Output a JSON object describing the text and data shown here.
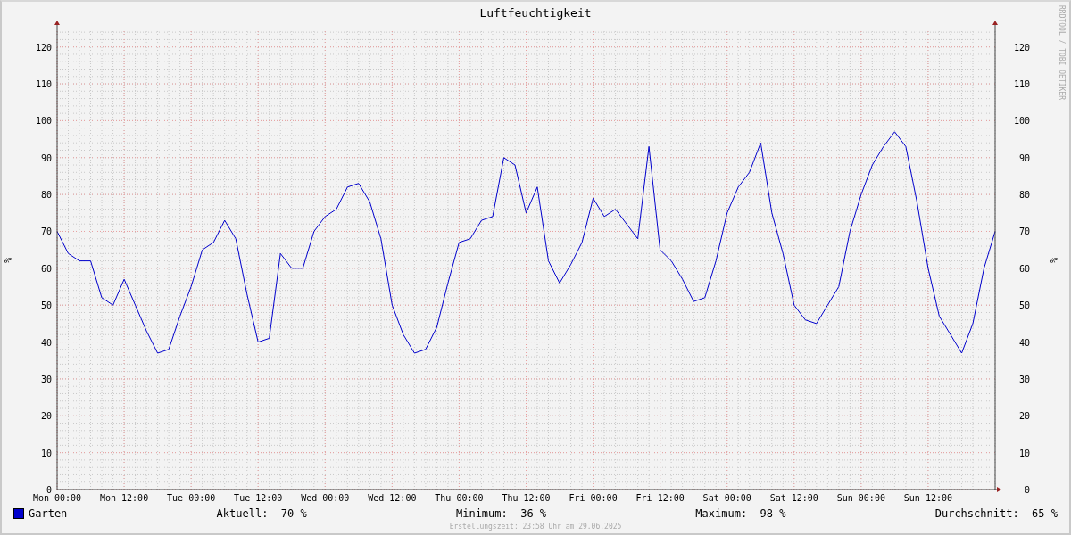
{
  "title": "Luftfeuchtigkeit",
  "credit": "RRDTOOL / TOBI OETIKER",
  "chart_data": {
    "type": "line",
    "grid": true,
    "ylabel": "%",
    "ylim": [
      0,
      125
    ],
    "categories": [
      "Mon 00:00",
      null,
      null,
      null,
      null,
      null,
      "Mon 12:00",
      null,
      null,
      null,
      null,
      null,
      "Tue 00:00",
      null,
      null,
      null,
      null,
      null,
      "Tue 12:00",
      null,
      null,
      null,
      null,
      null,
      "Wed 00:00",
      null,
      null,
      null,
      null,
      null,
      "Wed 12:00",
      null,
      null,
      null,
      null,
      null,
      "Thu 00:00",
      null,
      null,
      null,
      null,
      null,
      "Thu 12:00",
      null,
      null,
      null,
      null,
      null,
      "Fri 00:00",
      null,
      null,
      null,
      null,
      null,
      "Fri 12:00",
      null,
      null,
      null,
      null,
      null,
      "Sat 00:00",
      null,
      null,
      null,
      null,
      null,
      "Sat 12:00",
      null,
      null,
      null,
      null,
      null,
      "Sun 00:00",
      null,
      null,
      null,
      null,
      null,
      "Sun 12:00",
      null,
      null,
      null,
      null,
      null,
      null
    ],
    "yticks": [
      0,
      10,
      20,
      30,
      40,
      50,
      60,
      70,
      80,
      90,
      100,
      110,
      120
    ],
    "series": [
      {
        "color": "#0000cc",
        "values": [
          70,
          64,
          62,
          62,
          52,
          50,
          57,
          50,
          43,
          37,
          38,
          47,
          55,
          65,
          67,
          73,
          68,
          53,
          40,
          41,
          64,
          60,
          60,
          70,
          74,
          76,
          82,
          83,
          78,
          68,
          50,
          42,
          37,
          38,
          44,
          56,
          67,
          68,
          73,
          74,
          90,
          88,
          75,
          82,
          62,
          56,
          61,
          67,
          79,
          74,
          76,
          72,
          68,
          93,
          65,
          62,
          57,
          51,
          52,
          62,
          75,
          82,
          86,
          94,
          75,
          64,
          50,
          46,
          45,
          50,
          55,
          70,
          80,
          88,
          93,
          97,
          93,
          78,
          60,
          47,
          42,
          37,
          45,
          60,
          70
        ]
      }
    ]
  },
  "right_axis": {
    "label": "%",
    "ticks": [
      "120",
      "110",
      "100",
      "90",
      "80",
      "70",
      "60",
      "50",
      "40",
      "30",
      "20",
      "10",
      "0"
    ]
  },
  "legend": {
    "name": "Garten",
    "color": "#0000cc",
    "stats": [
      {
        "label": "Aktuell:",
        "value": "70 %"
      },
      {
        "label": "Minimum:",
        "value": "36 %"
      },
      {
        "label": "Maximum:",
        "value": "98 %"
      },
      {
        "label": "Durchschnitt:",
        "value": "65 %"
      }
    ]
  },
  "footer": "Erstellungszeit: 23:58 Uhr am 29.06.2025"
}
